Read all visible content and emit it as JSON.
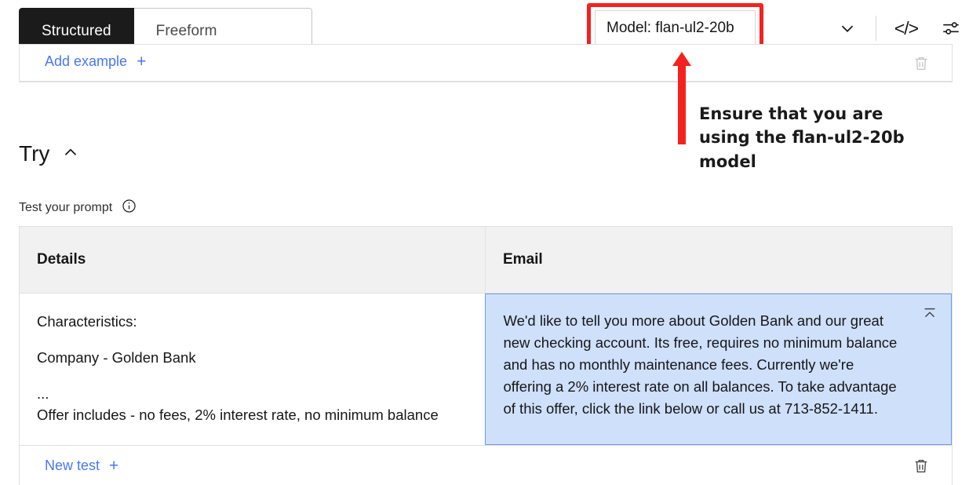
{
  "tabs": [
    {
      "label": "Structured",
      "selected": true
    },
    {
      "label": "Freeform",
      "selected": false
    }
  ],
  "toolbar": {
    "model_label": "Model: flan-ul2-20b",
    "chevron_icon": "chevron-down-icon",
    "code_icon": "code-icon",
    "code_glyph": "</>",
    "sliders_icon": "sliders-icon",
    "highlight_color": "#f4221f"
  },
  "examples_row": {
    "add_example_label": "Add example",
    "plus_glyph": "+",
    "delete_icon": "trash-icon"
  },
  "annotation": {
    "text": "Ensure that you are using the flan-ul2-20b model",
    "color": "#f4221f",
    "arrow": "up-arrow"
  },
  "try_section": {
    "title": "Try",
    "collapse_glyph": "∧",
    "subtitle": "Test your prompt",
    "info_icon": "info-icon"
  },
  "test_table": {
    "columns": [
      "Details",
      "Email"
    ],
    "rows": [
      {
        "details": {
          "line1": "Characteristics:",
          "line2": "Company - Golden Bank",
          "line3": "...",
          "line4": "Offer includes - no fees, 2% interest rate, no minimum balance"
        },
        "email": "We'd like to tell you more about Golden Bank and our great new checking account. Its free, requires no minimum balance and has no monthly maintenance fees. Currently we're offering a 2% interest rate on all balances. To take advantage of this offer, click the link below or call us at 713-852-1411.",
        "email_highlight_bg": "#cfe0fb",
        "email_highlight_border": "#6b9bf2",
        "collapse_icon": "collapse-up-icon"
      }
    ],
    "footer": {
      "new_test_label": "New test",
      "plus_glyph": "+",
      "delete_icon": "trash-icon"
    }
  }
}
